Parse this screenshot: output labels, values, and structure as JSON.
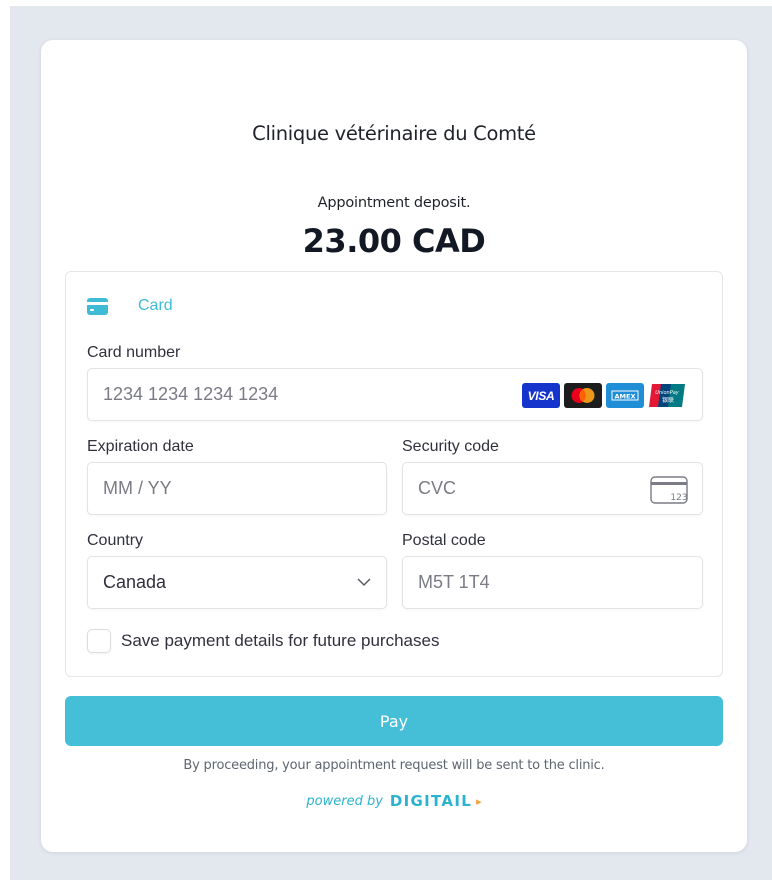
{
  "clinic": {
    "name": "Clinique vétérinaire du Comté"
  },
  "payment": {
    "description": "Appointment deposit.",
    "amount": "23.00 CAD"
  },
  "method_tab": {
    "label": "Card",
    "icon": "credit-card-icon",
    "color": "#3fbbd6"
  },
  "form": {
    "card_number": {
      "label": "Card number",
      "placeholder": "1234 1234 1234 1234"
    },
    "card_brands": [
      {
        "name": "visa-icon",
        "text": "VISA"
      },
      {
        "name": "mastercard-icon"
      },
      {
        "name": "amex-icon",
        "text": "AMEX"
      },
      {
        "name": "unionpay-icon",
        "text": "UnionPay 银联"
      }
    ],
    "expiration": {
      "label": "Expiration date",
      "placeholder": "MM / YY"
    },
    "security_code": {
      "label": "Security code",
      "placeholder": "CVC",
      "icon_text": "123"
    },
    "country": {
      "label": "Country",
      "value": "Canada"
    },
    "postal_code": {
      "label": "Postal code",
      "placeholder": "M5T 1T4"
    },
    "save_details": {
      "label": "Save payment details for future purchases",
      "checked": false
    }
  },
  "actions": {
    "pay_label": "Pay",
    "pay_color": "#45bfd8"
  },
  "footer": {
    "disclaimer": "By proceeding, your appointment request will be sent to the clinic.",
    "powered_by": "powered by",
    "brand": "DIGITAIL"
  }
}
